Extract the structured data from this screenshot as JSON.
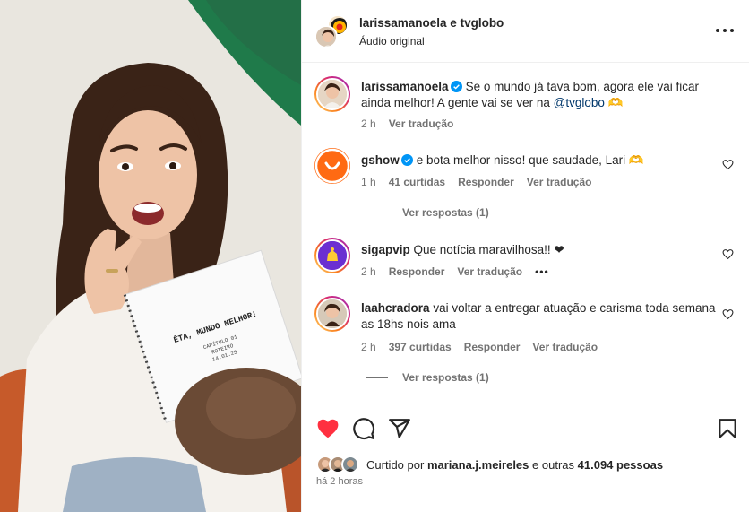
{
  "header": {
    "title": "larissamanoela e tvglobo",
    "subtitle": "Áudio original"
  },
  "notebook": {
    "title": "ÊTA, MUNDO MELHOR!",
    "line1": "CAPÍTULO 01",
    "line2": "ROTEIRO",
    "line3": "14.01.25"
  },
  "comments": [
    {
      "user": "larissamanoela",
      "verified": true,
      "text_before": "Se o mundo já tava bom, agora ele vai ficar ainda melhor! A gente vai se ver na ",
      "mention": "@tvglobo",
      "text_after": " 🫶",
      "time": "2 h",
      "translate": "Ver tradução"
    },
    {
      "user": "gshow",
      "verified": true,
      "text": "e bota melhor nisso! que saudade, Lari 🫶",
      "time": "1 h",
      "likes": "41 curtidas",
      "reply": "Responder",
      "translate": "Ver tradução",
      "replies": "Ver respostas (1)"
    },
    {
      "user": "sigapvip",
      "verified": false,
      "text": "Que notícia maravilhosa!! ❤",
      "time": "2 h",
      "reply": "Responder",
      "translate": "Ver tradução",
      "more": "•••"
    },
    {
      "user": "laahcradora",
      "verified": false,
      "text": "vai voltar a entregar atuação e carisma toda semana as 18hs nois ama",
      "time": "2 h",
      "likes": "397 curtidas",
      "reply": "Responder",
      "translate": "Ver tradução",
      "replies": "Ver respostas (1)"
    }
  ],
  "likes": {
    "prefix": "Curtido por",
    "user": "mariana.j.meireles",
    "suffix": "e outras",
    "count": "41.094 pessoas"
  },
  "posted": "há 2 horas",
  "colors": {
    "like_red": "#ff3040",
    "link_blue": "#00376b",
    "verified_blue": "#0095f6",
    "gshow_orange": "#ff6a13",
    "sigap_purple": "#6b2fd1",
    "story_ring_start": "#feda75",
    "story_ring_end": "#d62976"
  }
}
